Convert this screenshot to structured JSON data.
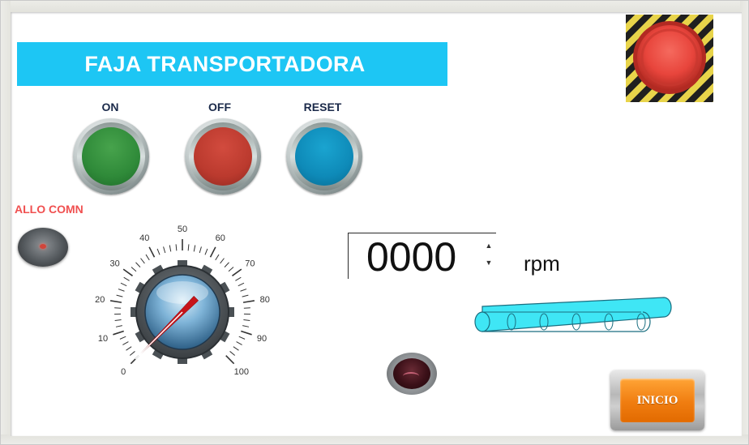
{
  "title": "FAJA TRANSPORTADORA",
  "buttons": {
    "on_label": "ON",
    "off_label": "OFF",
    "reset_label": "RESET"
  },
  "alarm": {
    "label": "ALLO COMN"
  },
  "knob": {
    "scale_labels": [
      "0",
      "10",
      "20",
      "30",
      "40",
      "50",
      "60",
      "70",
      "80",
      "90",
      "100"
    ],
    "value": 0,
    "min": 0,
    "max": 100
  },
  "numeric": {
    "value": "0000",
    "unit": "rpm"
  },
  "inicio_label": "INICIO",
  "colors": {
    "title_bg": "#1dc6f4",
    "on": "#2f8a39",
    "off": "#bb3a2e",
    "reset": "#0e8ab8",
    "alarm_text": "#f05050",
    "conveyor": "#3fe6f5",
    "estop": "#e8453c",
    "inicio": "#f07d10"
  }
}
